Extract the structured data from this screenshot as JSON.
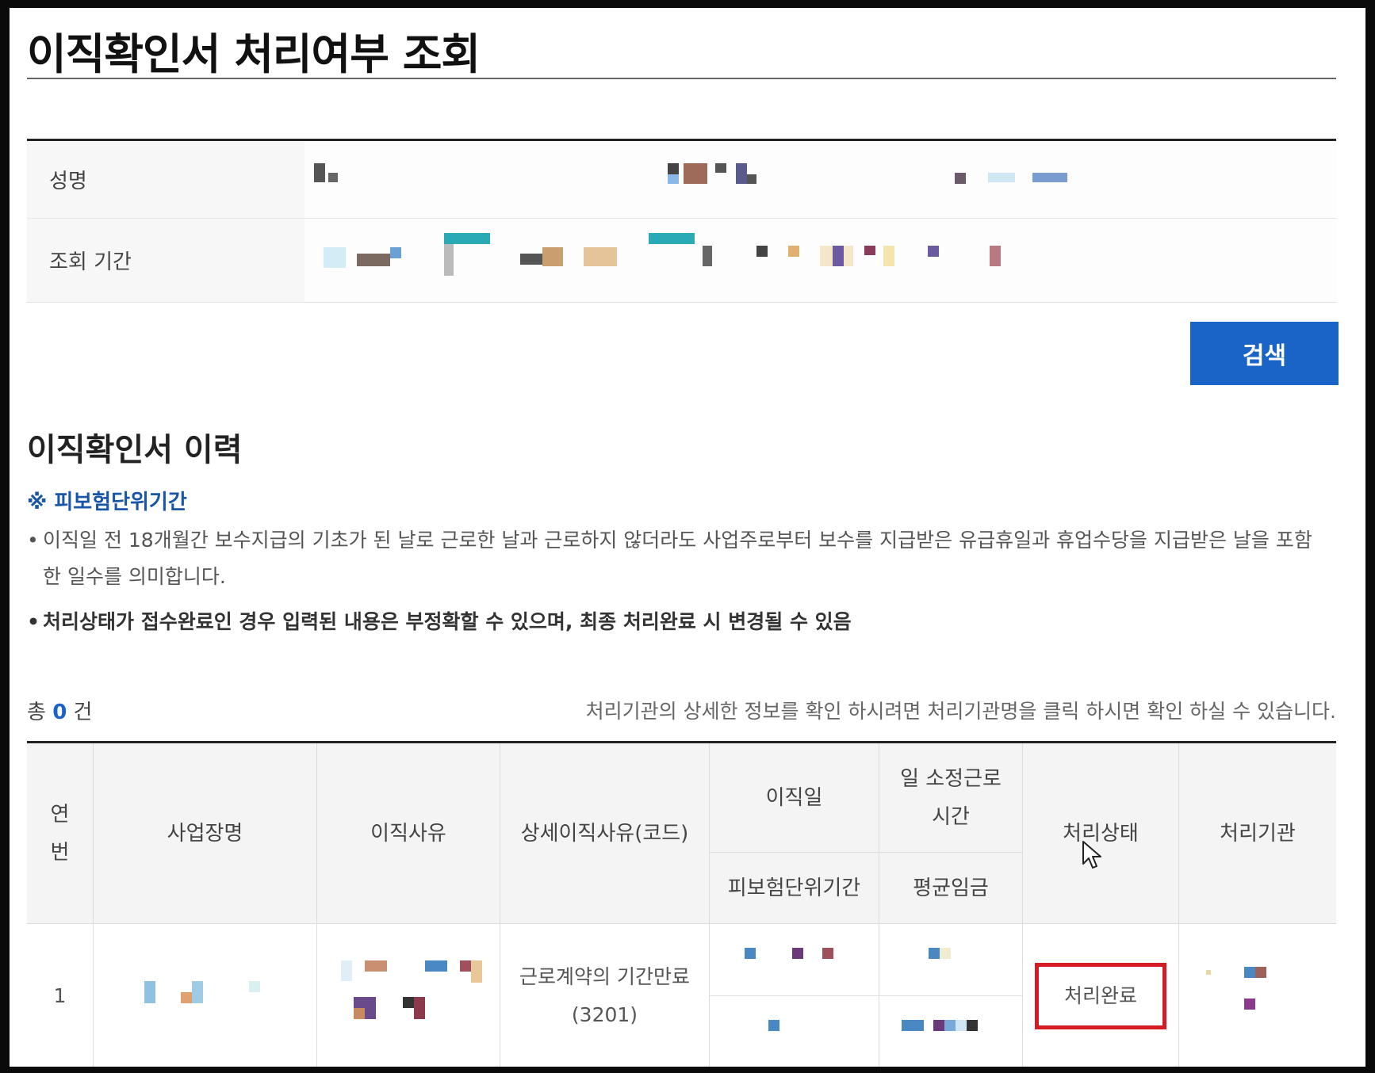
{
  "page_title": "이직확인서 처리여부 조회",
  "search_form": {
    "name_label": "성명",
    "period_label": "조회 기간",
    "search_button": "검색"
  },
  "history": {
    "section_title": "이직확인서 이력",
    "notice_title": "※ 피보험단위기간",
    "bullets": [
      "이직일 전 18개월간 보수지급의 기초가 된 날로 근로한 날과 근로하지 않더라도 사업주로부터 보수를 지급받은 유급휴일과 휴업수당을 지급받은 날을 포함한 일수를 의미합니다.",
      "처리상태가 접수완료인 경우 입력된 내용은 부정확할 수 있으며, 최종 처리완료 시 변경될 수 있음"
    ],
    "count_prefix": "총",
    "count": "0",
    "count_suffix": "건",
    "help_text": "처리기관의 상세한 정보를 확인 하시려면 처리기관명을 클릭 하시면 확인 하실 수 있습니다."
  },
  "table": {
    "headers": {
      "seq": "연\n번",
      "workplace": "사업장명",
      "reason": "이직사유",
      "detail_reason": "상세이직사유(코드)",
      "leave_date": "이직일",
      "daily_hours": "일 소정근로\n시간",
      "insured_period": "피보험단위기간",
      "avg_wage": "평균임금",
      "status": "처리상태",
      "agency": "처리기관"
    },
    "rows": [
      {
        "seq": "1",
        "detail_reason": "근로계약의 기간만료\n(3201)",
        "status": "처리완료"
      }
    ]
  },
  "colors": {
    "accent": "#1a63c7",
    "highlight_border": "#d51c24",
    "notice": "#1a56a8"
  }
}
